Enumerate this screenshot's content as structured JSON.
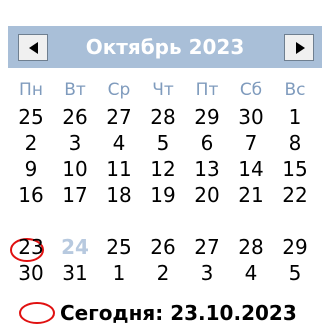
{
  "calendar": {
    "month_title": "Октябрь 2023",
    "prev_button_icon": "triangle-left-icon",
    "next_button_icon": "triangle-right-icon",
    "weekday_headers": [
      "Пн",
      "Вт",
      "Ср",
      "Чт",
      "Пт",
      "Сб",
      "Вс"
    ],
    "weeks": [
      [
        "25",
        "26",
        "27",
        "28",
        "29",
        "30",
        "1"
      ],
      [
        "2",
        "3",
        "4",
        "5",
        "6",
        "7",
        "8"
      ],
      [
        "9",
        "10",
        "11",
        "12",
        "13",
        "14",
        "15"
      ],
      [
        "16",
        "17",
        "18",
        "19",
        "20",
        "21",
        "22"
      ],
      [
        "23",
        "24",
        "25",
        "26",
        "27",
        "28",
        "29"
      ],
      [
        "30",
        "31",
        "1",
        "2",
        "3",
        "4",
        "5"
      ]
    ],
    "today_label": "Сегодня: 23.10.2023",
    "colors": {
      "header_bg": "#a9bfd8",
      "weekday_text": "#7f9bbd",
      "today_ring": "#e01010",
      "selected_day": "#b7c9df"
    }
  }
}
